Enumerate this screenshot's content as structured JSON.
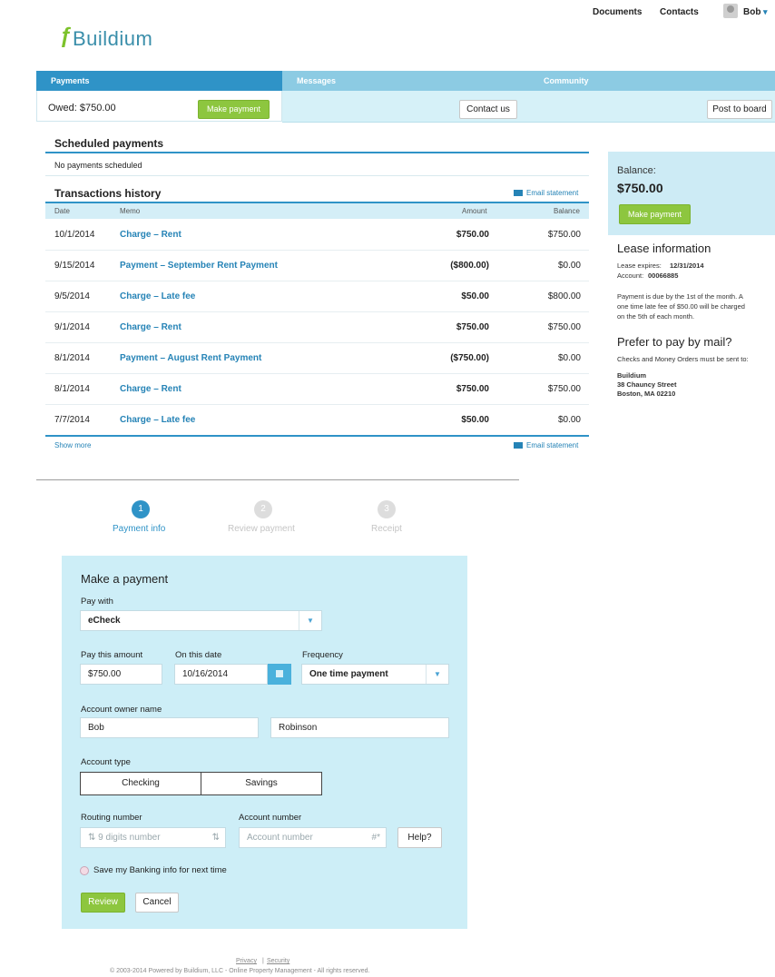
{
  "topnav": {
    "documents": "Documents",
    "contacts": "Contacts",
    "user": "Bob",
    "user_caret": "▾"
  },
  "logo": {
    "text": "Buildium"
  },
  "tabs": [
    {
      "label": "Payments"
    },
    {
      "label": "Messages"
    },
    {
      "label": "Community"
    }
  ],
  "payments_bar": {
    "owed": "Owed: $750.00",
    "make_payment": "Make payment"
  },
  "messages_bar": {
    "contact_us": "Contact us"
  },
  "community_bar": {
    "post_to_board": "Post to board"
  },
  "scheduled": {
    "title": "Scheduled payments",
    "empty": "No payments scheduled"
  },
  "transactions": {
    "title": "Transactions history",
    "email_statement": "Email statement",
    "columns": {
      "date": "Date",
      "memo": "Memo",
      "amount": "Amount",
      "balance": "Balance"
    },
    "rows": [
      {
        "date": "10/1/2014",
        "memo": "Charge – Rent",
        "amount": "$750.00",
        "balance": "$750.00"
      },
      {
        "date": "9/15/2014",
        "memo": "Payment – September Rent Payment",
        "amount": "($800.00)",
        "balance": "$0.00"
      },
      {
        "date": "9/5/2014",
        "memo": "Charge – Late fee",
        "amount": "$50.00",
        "balance": "$800.00"
      },
      {
        "date": "9/1/2014",
        "memo": "Charge – Rent",
        "amount": "$750.00",
        "balance": "$750.00"
      },
      {
        "date": "8/1/2014",
        "memo": "Payment – August Rent Payment",
        "amount": "($750.00)",
        "balance": "$0.00"
      },
      {
        "date": "8/1/2014",
        "memo": "Charge – Rent",
        "amount": "$750.00",
        "balance": "$750.00"
      },
      {
        "date": "7/7/2014",
        "memo": "Charge – Late fee",
        "amount": "$50.00",
        "balance": "$0.00"
      }
    ],
    "show_more": "Show more"
  },
  "sidebar": {
    "balance_label": "Balance:",
    "balance_value": "$750.00",
    "make_payment": "Make payment",
    "lease_title": "Lease information",
    "lease_expires_label": "Lease expires:",
    "lease_expires_value": "12/31/2014",
    "account_label": "Account:",
    "account_value": "00066885",
    "due_note_1": "Payment is due by the 1st of the month. A",
    "due_note_2": "one time late fee of $50.00 will be charged",
    "due_note_3": "on the 5th of each month.",
    "mail_title": "Prefer to pay by mail?",
    "mail_note": "Checks and Money Orders must be sent to:",
    "address_1": "Buildium",
    "address_2": "38 Chauncy Street",
    "address_3": "Boston, MA 02210"
  },
  "steps": [
    {
      "num": "1",
      "label": "Payment info"
    },
    {
      "num": "2",
      "label": "Review payment"
    },
    {
      "num": "3",
      "label": "Receipt"
    }
  ],
  "form": {
    "title": "Make a payment",
    "pay_with_label": "Pay with",
    "pay_with_value": "eCheck",
    "amount_label": "Pay this amount",
    "amount_value": "$750.00",
    "date_label": "On this date",
    "date_value": "10/16/2014",
    "frequency_label": "Frequency",
    "frequency_value": "One time payment",
    "owner_label": "Account owner name",
    "first_name": "Bob",
    "last_name": "Robinson",
    "account_type_label": "Account type",
    "checking": "Checking",
    "savings": "Savings",
    "routing_label": "Routing number",
    "routing_placeholder": "9 digits number",
    "account_number_label": "Account number",
    "account_number_placeholder": "Account number",
    "help": "Help?",
    "save_info": "Save my Banking info for next time",
    "review": "Review",
    "cancel": "Cancel"
  },
  "footer": {
    "privacy": "Privacy",
    "separator": "|",
    "security": "Security",
    "copyright": "© 2003-2014 Powered by Buildium, LLC - Online Property Management - All rights reserved."
  },
  "colors": {
    "accent_blue": "#2f93c7",
    "brand_green": "#8dc63f",
    "panel_light": "#cdeef7"
  }
}
